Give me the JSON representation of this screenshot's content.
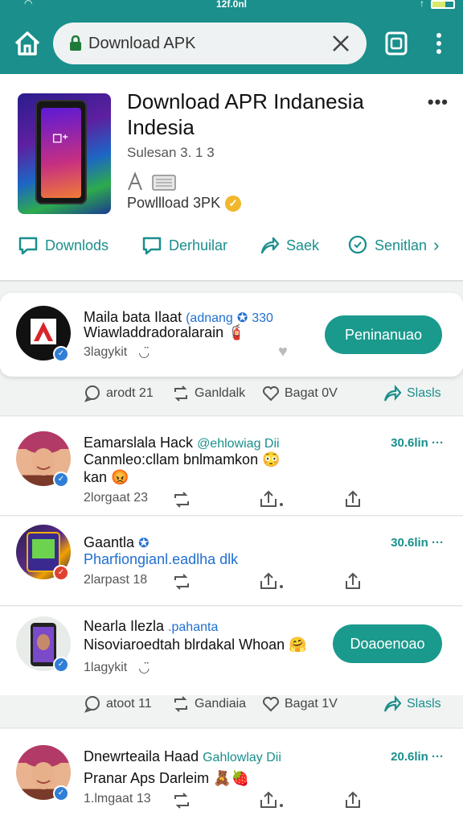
{
  "status_bar": {
    "time": "12f.0nl"
  },
  "browser": {
    "url_text": "Download APK"
  },
  "app": {
    "title": "Download APR Indanesia Indesia",
    "version": "Sulesan 3. 1 3",
    "download_label": "Powllload 3PK",
    "actions": [
      "Downlods",
      "Derhuilar",
      "Saek",
      "Senitlan"
    ]
  },
  "posts": [
    {
      "name": "Maila bata Ilaat",
      "handle": "(adnang",
      "count": "330",
      "text": "Wiawladdradoralarain",
      "meta": "3lagykit",
      "button": "Peninanuao",
      "stats": [
        "arodt 21",
        "Ganldalk",
        "Bagat 0V",
        "Slasls"
      ]
    },
    {
      "name": "Eamarslala Hack",
      "handle": "@ehlowiag Dii",
      "count": "30.6lin",
      "text_lines": [
        "Canmleo:cllam bnlmamkon",
        "kan"
      ],
      "meta": "2lorgaat 23"
    },
    {
      "name": "Gaantla",
      "count": "30.6lin",
      "text": "Pharfiongianl.eadlha dlk",
      "meta": "2larpast 18"
    },
    {
      "name": "Nearla Ilezla",
      "handle": ".pahanta",
      "text": "Nisoviaroedtah blrdakal Whoan",
      "meta": "1lagykit",
      "button": "Doaoenoao",
      "stats": [
        "atoot 11",
        "Gandiaia",
        "Bagat 1V",
        "Slasls"
      ]
    },
    {
      "name": "Dnewrteaila Haad",
      "handle": "Gahlowlay Dii",
      "count": "20.6lin",
      "text": "Pranar Aps Darleim",
      "meta": "1.lmgaat 13"
    }
  ],
  "colors": {
    "teal": "#1a8f8c",
    "button_teal": "#1a9a8d",
    "link_blue": "#1f6fd0"
  }
}
